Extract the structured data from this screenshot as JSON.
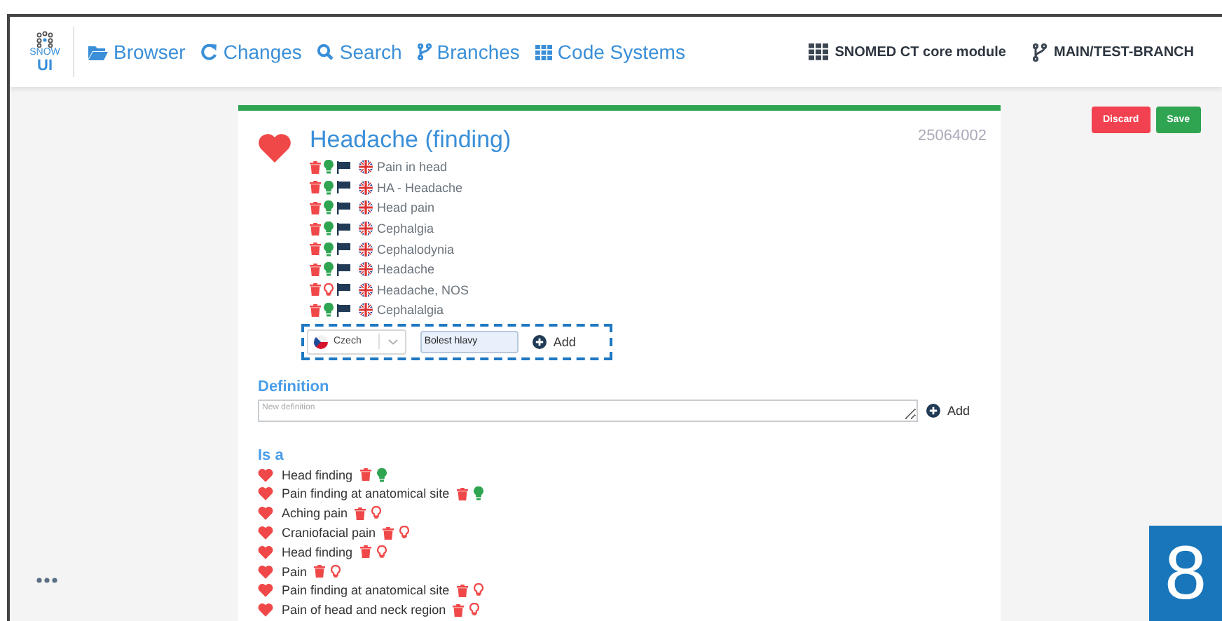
{
  "nav": {
    "logo": {
      "top": "SNOW",
      "bottom": "UI"
    },
    "items": [
      {
        "label": "Browser",
        "kind": "folder"
      },
      {
        "label": "Changes",
        "kind": "refresh"
      },
      {
        "label": "Search",
        "kind": "search"
      },
      {
        "label": "Branches",
        "kind": "branch"
      },
      {
        "label": "Code Systems",
        "kind": "grid"
      }
    ],
    "module": "SNOMED CT core module",
    "branch": "MAIN/TEST-BRANCH"
  },
  "actions": [
    {
      "label": "Discard",
      "kind": "danger"
    },
    {
      "label": "Save",
      "kind": "success"
    }
  ],
  "concept": {
    "title": "Headache (finding)",
    "id": "25064002",
    "descriptions": [
      {
        "term": "Pain in head",
        "active": true
      },
      {
        "term": "HA - Headache",
        "active": true
      },
      {
        "term": "Head pain",
        "active": true
      },
      {
        "term": "Cephalgia",
        "active": true
      },
      {
        "term": "Cephalodynia",
        "active": true
      },
      {
        "term": "Headache",
        "active": true
      },
      {
        "term": "Headache, NOS",
        "active": false
      },
      {
        "term": "Cephalalgia",
        "active": true
      }
    ],
    "new_description": {
      "language": "Czech",
      "value": "Bolest hlavy",
      "button": "Add"
    },
    "definition": {
      "heading": "Definition",
      "placeholder": "New definition",
      "button": "Add"
    },
    "is_a": {
      "heading": "Is a",
      "items": [
        {
          "term": "Head finding",
          "active": true
        },
        {
          "term": "Pain finding at anatomical site",
          "active": true
        },
        {
          "term": "Aching pain",
          "active": false
        },
        {
          "term": "Craniofacial pain",
          "active": false
        },
        {
          "term": "Head finding",
          "active": false
        },
        {
          "term": "Pain",
          "active": false
        },
        {
          "term": "Pain finding at anatomical site",
          "active": false
        },
        {
          "term": "Pain of head and neck region",
          "active": false
        }
      ]
    }
  },
  "step_badge": "8"
}
